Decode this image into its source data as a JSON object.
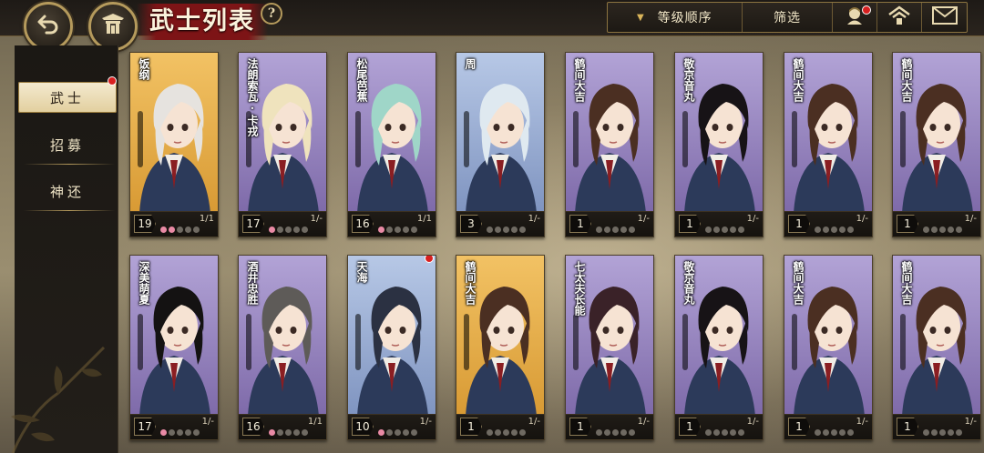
{
  "page": {
    "title": "武士列表",
    "help": "?",
    "back_icon": "back-arrow-icon",
    "home_icon": "castle-gate-icon"
  },
  "toolbar": {
    "sort_label": "等级顺序",
    "filter_label": "筛选",
    "icons": [
      "character-icon",
      "home-roof-icon",
      "mail-icon"
    ]
  },
  "sidebar": {
    "items": [
      {
        "label": "武士",
        "active": true,
        "badge": true
      },
      {
        "label": "招募",
        "active": false
      },
      {
        "label": "神还",
        "active": false
      }
    ]
  },
  "colors": {
    "accent_red": "#7d1416",
    "gold": "#b59a5c",
    "petal_on": "#e98aa5",
    "badge_red": "#d82020"
  },
  "cards": [
    {
      "name": "饭纲",
      "level": "19",
      "count": "1/1",
      "bg": "gold",
      "petals": 2,
      "hair": "#e6e3df"
    },
    {
      "name": "法朗索瓦·卡戎",
      "level": "17",
      "count": "1/-",
      "bg": "purple",
      "petals": 1,
      "hair": "#efe3bd"
    },
    {
      "name": "松尾芭蕉",
      "level": "16",
      "count": "1/1",
      "bg": "purple",
      "petals": 1,
      "hair": "#9fd6c8"
    },
    {
      "name": "周",
      "level": "3",
      "count": "1/-",
      "bg": "blue",
      "petals": 0,
      "hair": "#dfe9f0"
    },
    {
      "name": "鹤间大吉",
      "level": "1",
      "count": "1/-",
      "bg": "purple",
      "petals": 0,
      "hair": "#4b2f22"
    },
    {
      "name": "敬京音丸",
      "level": "1",
      "count": "1/-",
      "bg": "purple",
      "petals": 0,
      "hair": "#171316"
    },
    {
      "name": "鹤间大吉",
      "level": "1",
      "count": "1/-",
      "bg": "purple",
      "petals": 0,
      "hair": "#4b2f22"
    },
    {
      "name": "鹤间大吉",
      "level": "1",
      "count": "1/-",
      "bg": "purple",
      "petals": 0,
      "hair": "#4b2f22"
    },
    {
      "name": "深美萌夏",
      "level": "17",
      "count": "1/-",
      "bg": "purple",
      "petals": 1,
      "hair": "#141212"
    },
    {
      "name": "酒井忠胜",
      "level": "16",
      "count": "1/1",
      "bg": "purple",
      "petals": 1,
      "hair": "#5e5b58"
    },
    {
      "name": "天海",
      "level": "10",
      "count": "1/-",
      "bg": "blue",
      "petals": 1,
      "hair": "#2b3142",
      "badge": true
    },
    {
      "name": "鹤间大吉",
      "level": "1",
      "count": "1/-",
      "bg": "gold",
      "petals": 0,
      "hair": "#4b2f22"
    },
    {
      "name": "七太夫长能",
      "level": "1",
      "count": "1/-",
      "bg": "purple",
      "petals": 0,
      "hair": "#3a2228"
    },
    {
      "name": "敬京音丸",
      "level": "1",
      "count": "1/-",
      "bg": "purple",
      "petals": 0,
      "hair": "#171316"
    },
    {
      "name": "鹤间大吉",
      "level": "1",
      "count": "1/-",
      "bg": "purple",
      "petals": 0,
      "hair": "#4b2f22"
    },
    {
      "name": "鹤间大吉",
      "level": "1",
      "count": "1/-",
      "bg": "purple",
      "petals": 0,
      "hair": "#4b2f22"
    }
  ]
}
